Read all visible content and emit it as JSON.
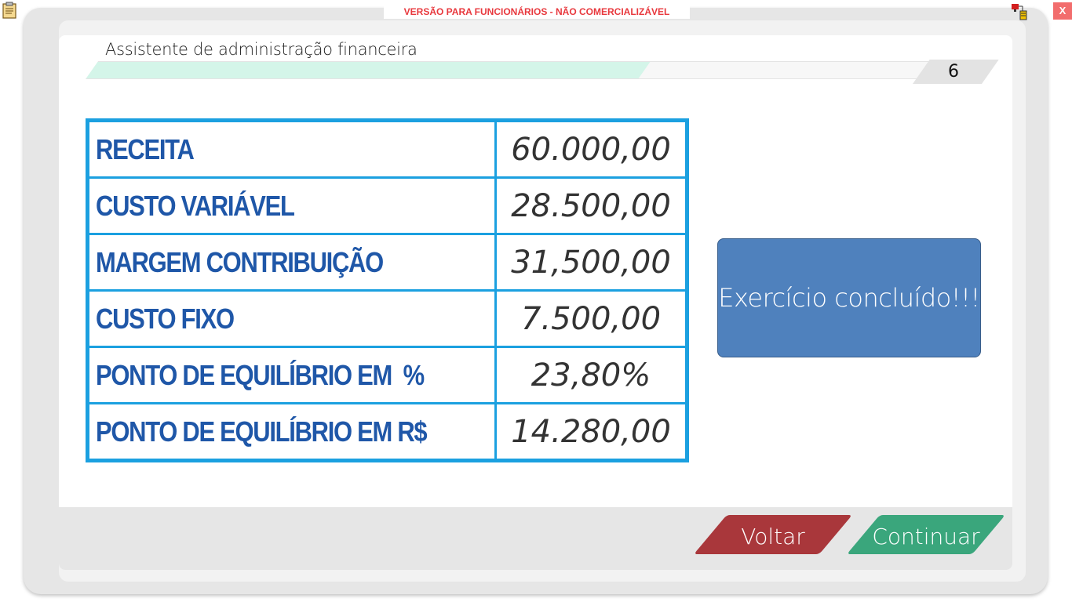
{
  "banner": {
    "text": "VERSÃO PARA FUNCIONÁRIOS - NÃO COMERCIALIZÁVEL"
  },
  "window": {
    "close_label": "X"
  },
  "header": {
    "title": "Assistente de administração financeira",
    "page_number": "6"
  },
  "progress": {
    "fraction": 0.62
  },
  "table": {
    "rows": [
      {
        "label": "RECEITA",
        "value": "60.000,00"
      },
      {
        "label": "CUSTO VARIÁVEL",
        "value": "28.500,00"
      },
      {
        "label": "MARGEM CONTRIBUIÇÃO",
        "value": "31,500,00"
      },
      {
        "label": "CUSTO FIXO",
        "value": "7.500,00"
      },
      {
        "label": "PONTO DE EQUILÍBRIO EM  %",
        "value": "23,80%"
      },
      {
        "label": "PONTO DE EQUILÍBRIO EM R$",
        "value": "14.280,00"
      }
    ]
  },
  "status": {
    "message": "Exercício concluído!!!"
  },
  "footer": {
    "back_label": "Voltar",
    "continue_label": "Continuar"
  },
  "icons": {
    "clipboard": "clipboard-icon",
    "network": "network-status-icon"
  },
  "colors": {
    "table_border": "#1ba0e0",
    "label_text": "#1f57a8",
    "status_box": "#4f81bd",
    "back_button": "#a9373b",
    "continue_button": "#3aa67c",
    "banner_text": "#e8383d"
  }
}
